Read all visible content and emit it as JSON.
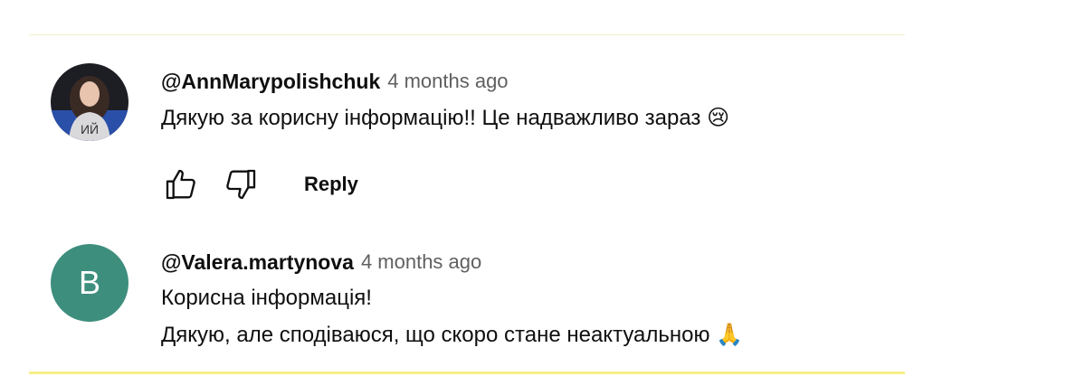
{
  "comments": [
    {
      "author": "@AnnMarypolishchuk",
      "time": "4 months ago",
      "text": "Дякую за корисну інформацію!! Це надважливо зараз",
      "emoji": "😢",
      "avatar_icon": "profile-photo",
      "reply_label": "Reply"
    },
    {
      "author": "@Valera.martynova",
      "time": "4 months ago",
      "avatar_letter": "B",
      "avatar_color": "#3e8e7e",
      "text_line1": "Корисна інформація!",
      "text_line2": "Дякую, але сподіваюся, що скоро стане неактуальною",
      "emoji": "🙏"
    }
  ]
}
